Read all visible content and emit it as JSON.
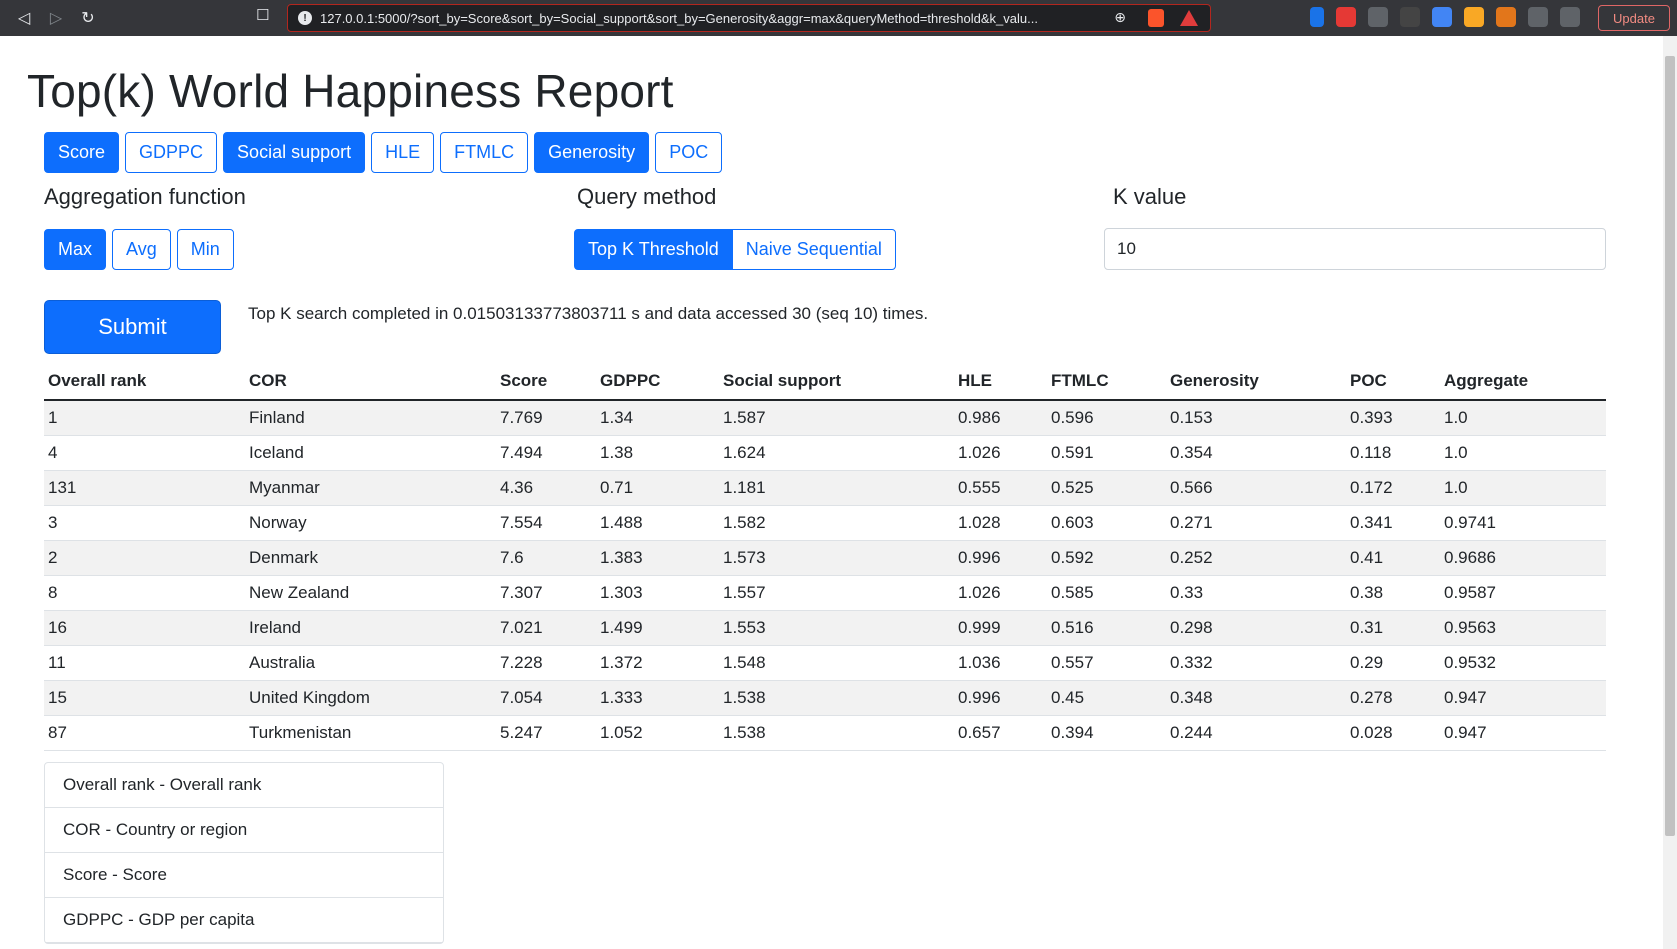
{
  "browser": {
    "url": "127.0.0.1:5000/?sort_by=Score&sort_by=Social_support&sort_by=Generosity&aggr=max&queryMethod=threshold&k_valu...",
    "update_label": "Update"
  },
  "page": {
    "title": "Top(k) World Happiness Report"
  },
  "sort_buttons": [
    {
      "label": "Score",
      "active": true
    },
    {
      "label": "GDPPC",
      "active": false
    },
    {
      "label": "Social support",
      "active": true
    },
    {
      "label": "HLE",
      "active": false
    },
    {
      "label": "FTMLC",
      "active": false
    },
    {
      "label": "Generosity",
      "active": true
    },
    {
      "label": "POC",
      "active": false
    }
  ],
  "aggregation": {
    "label": "Aggregation function",
    "options": [
      {
        "label": "Max",
        "active": true
      },
      {
        "label": "Avg",
        "active": false
      },
      {
        "label": "Min",
        "active": false
      }
    ]
  },
  "query_method": {
    "label": "Query method",
    "options": [
      {
        "label": "Top K Threshold",
        "active": true
      },
      {
        "label": "Naive Sequential",
        "active": false
      }
    ]
  },
  "k_value": {
    "label": "K value",
    "value": "10"
  },
  "submit_label": "Submit",
  "status_text": "Top K search completed in 0.01503133773803711 s and data accessed 30 (seq 10) times.",
  "table": {
    "headers": [
      "Overall rank",
      "COR",
      "Score",
      "GDPPC",
      "Social support",
      "HLE",
      "FTMLC",
      "Generosity",
      "POC",
      "Aggregate"
    ],
    "rows": [
      [
        "1",
        "Finland",
        "7.769",
        "1.34",
        "1.587",
        "0.986",
        "0.596",
        "0.153",
        "0.393",
        "1.0"
      ],
      [
        "4",
        "Iceland",
        "7.494",
        "1.38",
        "1.624",
        "1.026",
        "0.591",
        "0.354",
        "0.118",
        "1.0"
      ],
      [
        "131",
        "Myanmar",
        "4.36",
        "0.71",
        "1.181",
        "0.555",
        "0.525",
        "0.566",
        "0.172",
        "1.0"
      ],
      [
        "3",
        "Norway",
        "7.554",
        "1.488",
        "1.582",
        "1.028",
        "0.603",
        "0.271",
        "0.341",
        "0.9741"
      ],
      [
        "2",
        "Denmark",
        "7.6",
        "1.383",
        "1.573",
        "0.996",
        "0.592",
        "0.252",
        "0.41",
        "0.9686"
      ],
      [
        "8",
        "New Zealand",
        "7.307",
        "1.303",
        "1.557",
        "1.026",
        "0.585",
        "0.33",
        "0.38",
        "0.9587"
      ],
      [
        "16",
        "Ireland",
        "7.021",
        "1.499",
        "1.553",
        "0.999",
        "0.516",
        "0.298",
        "0.31",
        "0.9563"
      ],
      [
        "11",
        "Australia",
        "7.228",
        "1.372",
        "1.548",
        "1.036",
        "0.557",
        "0.332",
        "0.29",
        "0.9532"
      ],
      [
        "15",
        "United Kingdom",
        "7.054",
        "1.333",
        "1.538",
        "0.996",
        "0.45",
        "0.348",
        "0.278",
        "0.947"
      ],
      [
        "87",
        "Turkmenistan",
        "5.247",
        "1.052",
        "1.538",
        "0.657",
        "0.394",
        "0.244",
        "0.028",
        "0.947"
      ]
    ]
  },
  "legend": [
    "Overall rank - Overall rank",
    "COR - Country or region",
    "Score - Score",
    "GDPPC - GDP per capita"
  ]
}
